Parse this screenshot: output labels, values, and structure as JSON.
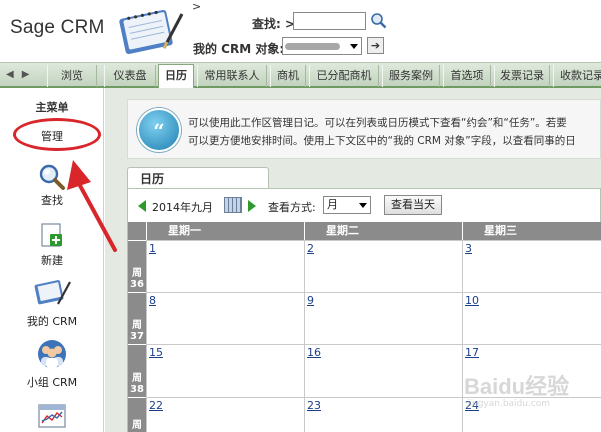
{
  "header": {
    "brand": "Sage CRM",
    "gt_mark": ">",
    "find_label": "查找: >",
    "find_value": "",
    "crm_label": "我的 CRM 对象:",
    "crm_go": "➔"
  },
  "tabs": [
    {
      "label": "浏览",
      "active": false
    },
    {
      "label": "仪表盘",
      "active": false
    },
    {
      "label": "日历",
      "active": true
    },
    {
      "label": "常用联系人",
      "active": false
    },
    {
      "label": "商机",
      "active": false
    },
    {
      "label": "已分配商机",
      "active": false
    },
    {
      "label": "服务案例",
      "active": false
    },
    {
      "label": "首选项",
      "active": false
    },
    {
      "label": "发票记录",
      "active": false
    },
    {
      "label": "收款记录",
      "active": false
    }
  ],
  "sidebar": {
    "title": "主菜单",
    "manage": "管理",
    "items": [
      {
        "label": "查找",
        "icon": "magnifier-icon"
      },
      {
        "label": "新建",
        "icon": "new-icon"
      },
      {
        "label": "我的 CRM",
        "icon": "my-crm-icon"
      },
      {
        "label": "小组 CRM",
        "icon": "team-crm-icon"
      },
      {
        "label": "",
        "icon": "report-icon"
      }
    ]
  },
  "info": {
    "line1": "可以使用此工作区管理日记。可以在列表或日历模式下查看“约会”和“任务”。若要",
    "line2": "可以更方便地安排时间。使用上下文区中的“我的 CRM 对象”字段，以查看同事的日"
  },
  "calendar": {
    "tab_label": "日历",
    "month": "2014年九月",
    "view_label": "查看方式:",
    "view_value": "月",
    "today_button": "查看当天",
    "day_headers": [
      "星期一",
      "星期二",
      "星期三"
    ],
    "weeks": [
      {
        "week_char": "周",
        "week_num": "36",
        "days": [
          "1",
          "2",
          "3"
        ]
      },
      {
        "week_char": "周",
        "week_num": "37",
        "days": [
          "8",
          "9",
          "10"
        ]
      },
      {
        "week_char": "周",
        "week_num": "38",
        "days": [
          "15",
          "16",
          "17"
        ]
      },
      {
        "week_char": "周",
        "week_num": "39",
        "days": [
          "22",
          "23",
          "24"
        ]
      }
    ]
  },
  "watermark": {
    "text": "Baidu经验",
    "sub": "jingyan.baidu.com"
  },
  "colors": {
    "tab_bar": "#c3d3bf",
    "accent_green": "#2e9a2e",
    "annotation_red": "#d8262a",
    "grid_header": "#8b8b8b"
  }
}
